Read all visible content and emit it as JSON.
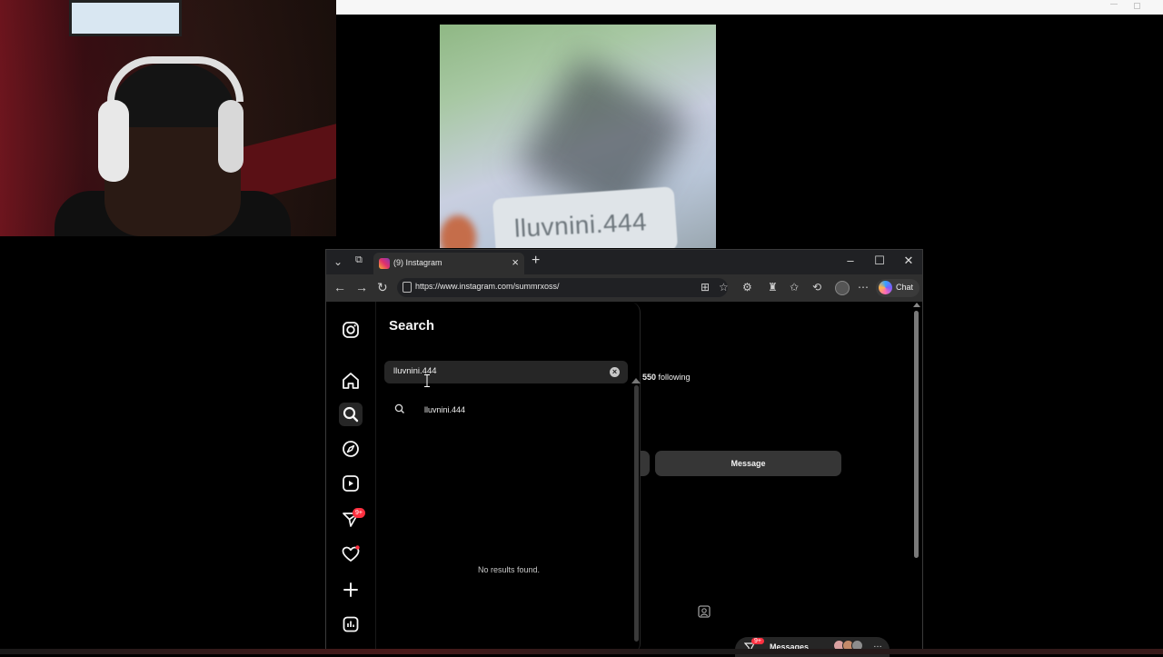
{
  "browser": {
    "tab_title": "(9) Instagram",
    "url": "https://www.instagram.com/summrxoss/",
    "chat_label": "Chat"
  },
  "photo": {
    "card_text": "lluvnini.444"
  },
  "search": {
    "title": "Search",
    "query": "lluvnini.444",
    "suggestion": "lluvnini.444",
    "empty_message": "No results found."
  },
  "profile": {
    "following_count": "550",
    "following_label": "following",
    "message_button": "Message"
  },
  "messages_pill": {
    "label": "Messages",
    "badge": "9+"
  },
  "sidebar": {
    "messages_badge": "9+"
  }
}
